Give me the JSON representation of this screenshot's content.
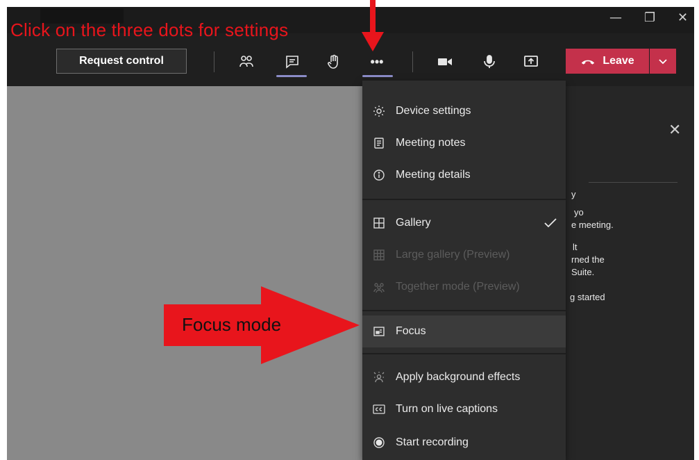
{
  "annotations": {
    "top_instruction": "Click on the three dots for settings",
    "focus_label": "Focus mode"
  },
  "window_controls": {
    "minimize": "—",
    "restore": "❐",
    "close": "✕"
  },
  "toolbar": {
    "request_control_label": "Request control",
    "leave_label": "Leave",
    "more_label": "•••"
  },
  "menu": {
    "items": [
      {
        "label": "Device settings",
        "icon": "gear-icon",
        "enabled": true
      },
      {
        "label": "Meeting notes",
        "icon": "notes-icon",
        "enabled": true
      },
      {
        "label": "Meeting details",
        "icon": "info-icon",
        "enabled": true
      },
      {
        "label": "Gallery",
        "icon": "gallery-icon",
        "enabled": true,
        "checked": true
      },
      {
        "label": "Large gallery (Preview)",
        "icon": "large-gallery-icon",
        "enabled": false
      },
      {
        "label": "Together mode (Preview)",
        "icon": "together-mode-icon",
        "enabled": false
      },
      {
        "label": "Focus",
        "icon": "focus-icon",
        "enabled": true,
        "highlighted": true
      },
      {
        "label": "Apply background effects",
        "icon": "background-effects-icon",
        "enabled": true
      },
      {
        "label": "Turn on live captions",
        "icon": "captions-icon",
        "enabled": true
      },
      {
        "label": "Start recording",
        "icon": "record-icon",
        "enabled": true
      }
    ]
  },
  "panel": {
    "close": "✕",
    "fragments": [
      "y",
      "yo",
      "e meeting.",
      "lt",
      "rned the",
      "Suite.",
      "g started"
    ]
  },
  "colors": {
    "accent_underline": "#8b8cc7",
    "leave_red": "#c4314b",
    "annotation_red": "#e8151c"
  }
}
